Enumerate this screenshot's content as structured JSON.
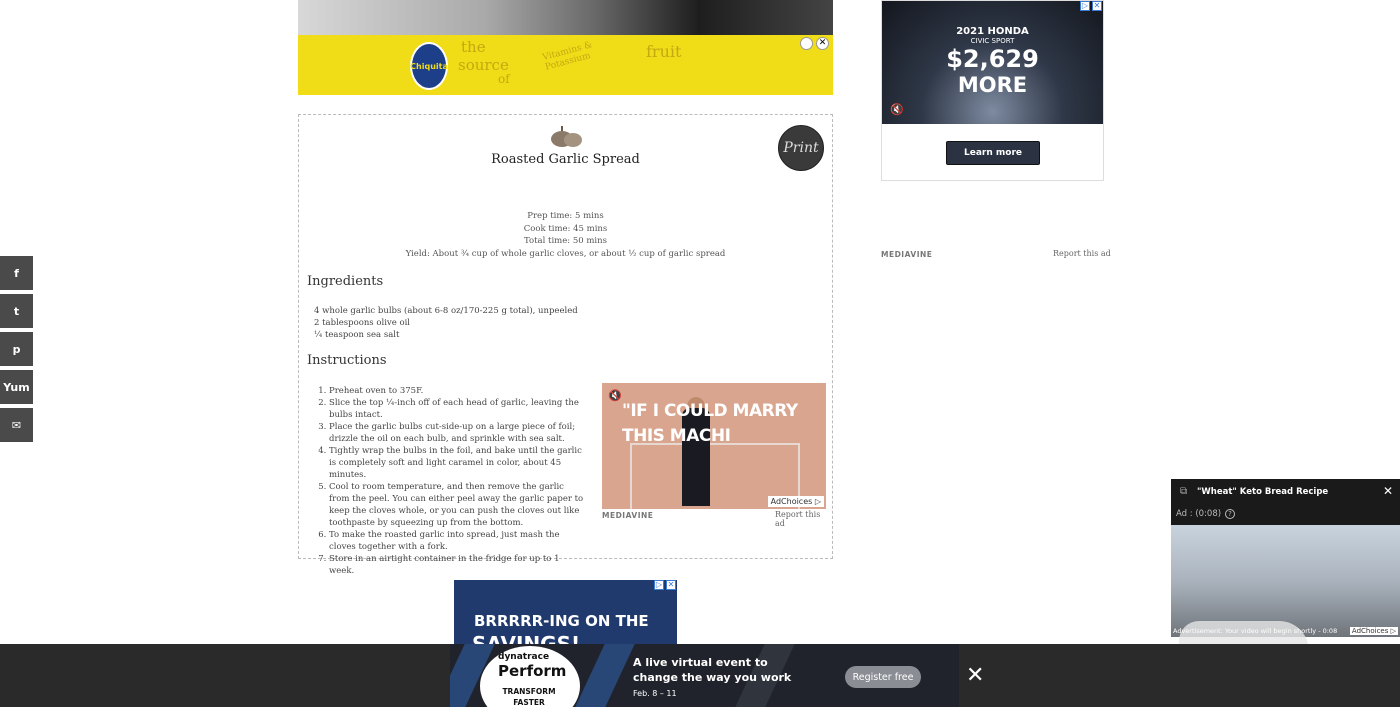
{
  "social": {
    "facebook": "f",
    "twitter": "t",
    "pinterest": "p",
    "yummly": "Yum",
    "email": "✉"
  },
  "top_banner": {
    "brand": "Chiquita",
    "line1": "the",
    "line2": "source",
    "line3": "of",
    "line4": "Vitamins & Potassium",
    "line5": "fruit",
    "close": "✕"
  },
  "recipe": {
    "title": "Roasted Garlic Spread",
    "print_label": "Print",
    "prep_time": "Prep time:  5 mins",
    "cook_time": "Cook time:  45 mins",
    "total_time": "Total time:  50 mins",
    "yield": "Yield: About ¾ cup of whole garlic cloves, or about ½ cup of garlic spread",
    "ingredients_heading": "Ingredients",
    "ingredients": [
      "4 whole garlic bulbs (about 6-8 oz/170-225 g total), unpeeled",
      "2 tablespoons olive oil",
      "¼ teaspoon sea salt"
    ],
    "instructions_heading": "Instructions",
    "instructions": [
      "Preheat oven to 375F.",
      "Slice the top ¼-inch off of each head of garlic, leaving the bulbs intact.",
      "Place the garlic bulbs cut-side-up on a large piece of foil; drizzle the oil on each bulb, and sprinkle with sea salt.",
      "Tightly wrap the bulbs in the foil, and bake until the garlic is completely soft and light caramel in color, about 45 minutes.",
      "Cool to room temperature, and then remove the garlic from the peel. You can either peel away the garlic paper to keep the cloves whole, or you can push the cloves out like toothpaste by squeezing up from the bottom.",
      "To make the roasted garlic into spread, just mash the cloves together with a fork.",
      "Store in an airtight container in the fridge for up to 1 week."
    ]
  },
  "inline_ad": {
    "line1": "\"IF I COULD MARRY",
    "line2": "THIS  MACHI",
    "adchoices": "AdChoices ▷",
    "mediavine": "MEDIAVINE",
    "report": "Report this ad"
  },
  "honda_ad": {
    "line1": "2021 HONDA",
    "line2": "CIVIC SPORT",
    "price": "$2,629",
    "more": "MORE",
    "learn_more": "Learn more",
    "mediavine": "MEDIAVINE",
    "report": "Report this ad"
  },
  "bottom_ad": {
    "line1": "BRRRRR-ING ON THE",
    "line2": "SAVINGS!"
  },
  "float_video": {
    "title": "\"Wheat\" Keto Bread Recipe",
    "ad_time": "Ad : (0:08)",
    "caption": "Advertisement: Your video will begin shortly - 0:08",
    "adchoices": "AdChoices ▷",
    "close": "✕"
  },
  "sticky_ad": {
    "brand": "dynatrace",
    "product": "Perform",
    "tagline": "TRANSFORM FASTER",
    "headline1": "A live virtual event to",
    "headline2": "change the way you work",
    "date": "Feb. 8 – 11",
    "register": "Register free",
    "close": "✕"
  }
}
